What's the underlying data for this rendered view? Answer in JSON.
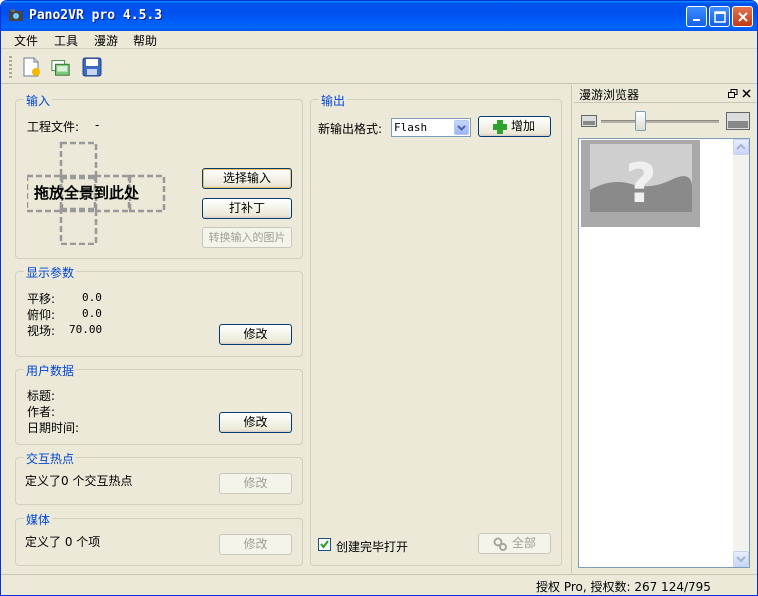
{
  "window": {
    "title": "Pano2VR pro 4.5.3"
  },
  "menu": [
    "文件",
    "工具",
    "漫游",
    "帮助"
  ],
  "toolbar": {
    "icons": [
      "new-project-icon",
      "open-project-icon",
      "save-icon"
    ]
  },
  "input_group": {
    "title": "输入",
    "project_file_label": "工程文件:",
    "project_file_value": "-",
    "drop_text": "拖放全景到此处",
    "select_input": "选择输入",
    "patch": "打补丁",
    "convert": "转换输入的图片"
  },
  "display_params": {
    "title": "显示参数",
    "pan_label": "平移:",
    "pan_value": "0.0",
    "tilt_label": "俯仰:",
    "tilt_value": "0.0",
    "fov_label": "视场:",
    "fov_value": "70.00",
    "modify": "修改"
  },
  "user_data": {
    "title": "用户数据",
    "title_label": "标题:",
    "author_label": "作者:",
    "date_label": "日期时间:",
    "modify": "修改"
  },
  "hotspots": {
    "title": "交互热点",
    "text": "定义了0 个交互热点",
    "modify": "修改"
  },
  "media": {
    "title": "媒体",
    "text": "定义了 0 个项",
    "modify": "修改"
  },
  "output": {
    "title": "输出",
    "format_label": "新输出格式:",
    "format_value": "Flash",
    "add": "增加",
    "open_after_build": "创建完毕打开",
    "open_after_build_checked": true,
    "all": "全部"
  },
  "tour_browser": {
    "title": "漫游浏览器"
  },
  "status": {
    "text": "授权 Pro, 授权数: 267 124/795"
  },
  "colors": {
    "titlebar": "#0054e3",
    "group_title": "#0046d5",
    "window_bg": "#ece9d8"
  }
}
